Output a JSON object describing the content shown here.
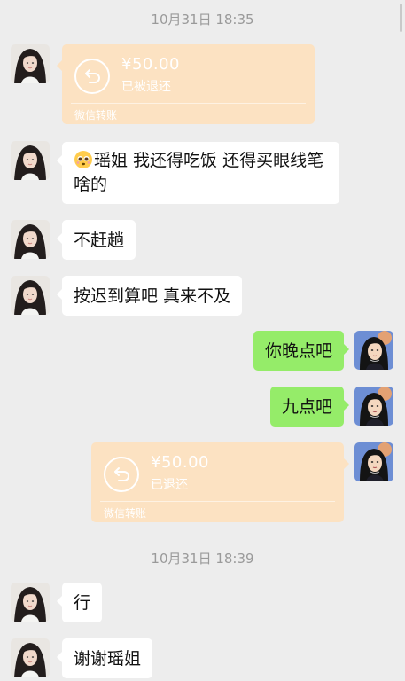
{
  "timestamps": [
    "10月31日 18:35",
    "10月31日 18:39"
  ],
  "transfer1": {
    "amount": "¥50.00",
    "status": "已被退还",
    "brand": "微信转账"
  },
  "msg_yaojie": {
    "text": "瑶姐 我还得吃饭 还得买眼线笔啥的"
  },
  "msg_bugantang": {
    "text": "不赶趟"
  },
  "msg_chidao": {
    "text": "按迟到算吧 真来不及"
  },
  "msg_wandian": {
    "text": "你晚点吧"
  },
  "msg_jiudian": {
    "text": "九点吧"
  },
  "transfer2": {
    "amount": "¥50.00",
    "status": "已退还",
    "brand": "微信转账"
  },
  "msg_xing": {
    "text": "行"
  },
  "msg_xiexie": {
    "text": "谢谢瑶姐"
  },
  "colors": {
    "background": "#ededed",
    "sent_bubble": "#95ec69",
    "received_bubble": "#ffffff",
    "transfer": "#fce2c2"
  },
  "icons": {
    "emoji": "pleading-face-emoji",
    "transfer": "return-arrow-icon"
  }
}
